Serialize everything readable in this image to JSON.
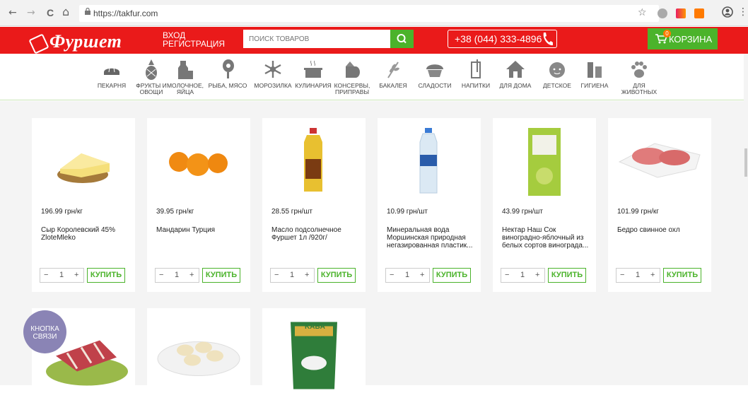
{
  "browser": {
    "url": "https://takfur.com",
    "back_icon": "←",
    "forward_icon": "→",
    "reload_icon": "C",
    "home_icon": "⌂",
    "lock_icon": "🔒",
    "star_icon": "☆",
    "account_icon": "●",
    "menu_icon": "⋮"
  },
  "header": {
    "logo": "Фуршет",
    "login": "ВХОД",
    "register": "РЕГИСТРАЦИЯ",
    "search_placeholder": "ПОИСК ТОВАРОВ",
    "phone": "+38 (044) 333-4896",
    "cart_label": "КОРЗИНА",
    "cart_count": "0",
    "brand_color": "#ea1a1a",
    "accent_color": "#4bb32b"
  },
  "categories": [
    {
      "label": "ПЕКАРНЯ",
      "label2": ""
    },
    {
      "label": "ФРУКТЫ И",
      "label2": "ОВОЩИ"
    },
    {
      "label": "МОЛОЧНОЕ,",
      "label2": "ЯЙЦА"
    },
    {
      "label": "РЫБА, МЯСО",
      "label2": ""
    },
    {
      "label": "МОРОЗИЛКА",
      "label2": ""
    },
    {
      "label": "КУЛИНАРИЯ",
      "label2": ""
    },
    {
      "label": "КОНСЕРВЫ,",
      "label2": "ПРИПРАВЫ"
    },
    {
      "label": "БАКАЛЕЯ",
      "label2": ""
    },
    {
      "label": "СЛАДОСТИ",
      "label2": ""
    },
    {
      "label": "НАПИТКИ",
      "label2": ""
    },
    {
      "label": "ДЛЯ ДОМА",
      "label2": ""
    },
    {
      "label": "ДЕТСКОЕ",
      "label2": ""
    },
    {
      "label": "ГИГИЕНА",
      "label2": ""
    },
    {
      "label": "ДЛЯ",
      "label2": "ЖИВОТНЫХ"
    }
  ],
  "products": [
    {
      "price": "196.99 грн/кг",
      "name": "Сыр Королевский 45% ZloteMleko",
      "qty": "1",
      "buy": "КУПИТЬ"
    },
    {
      "price": "39.95 грн/кг",
      "name": "Мандарин Турция",
      "qty": "1",
      "buy": "КУПИТЬ"
    },
    {
      "price": "28.55 грн/шт",
      "name": "Масло подсолнечное Фуршет 1л /920г/",
      "qty": "1",
      "buy": "КУПИТЬ"
    },
    {
      "price": "10.99 грн/шт",
      "name": "Минеральная вода Моршинская природная негазированная пластик...",
      "qty": "1",
      "buy": "КУПИТЬ"
    },
    {
      "price": "43.99 грн/шт",
      "name": "Нектар Наш Сок виноградно-яблочный из белых сортов винограда...",
      "qty": "1",
      "buy": "КУПИТЬ"
    },
    {
      "price": "101.99 грн/кг",
      "name": "Бедро свинное охл",
      "qty": "1",
      "buy": "КУПИТЬ"
    }
  ],
  "contact_button": {
    "line1": "КНОПКА",
    "line2": "СВЯЗИ"
  },
  "product_images": {
    "coffee_label": "KABA"
  }
}
